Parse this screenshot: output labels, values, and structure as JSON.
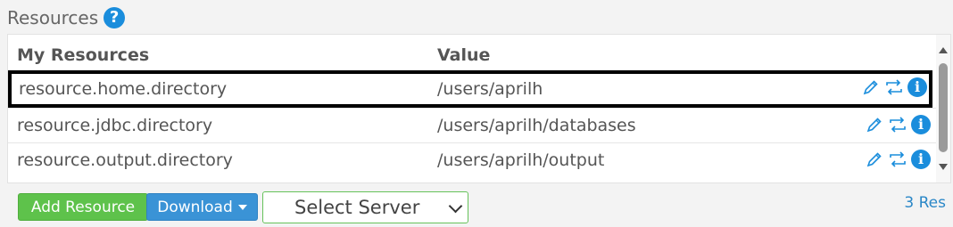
{
  "panel": {
    "title": "Resources",
    "help_icon": "question-circle-icon"
  },
  "table": {
    "headers": [
      "My Resources",
      "Value"
    ],
    "rows": [
      {
        "key": "resource.home.directory",
        "value": "/users/aprilh",
        "selected": true
      },
      {
        "key": "resource.jdbc.directory",
        "value": "/users/aprilh/databases",
        "selected": false
      },
      {
        "key": "resource.output.directory",
        "value": "/users/aprilh/output",
        "selected": false
      }
    ],
    "row_actions": [
      "pencil-edit-icon",
      "swap-arrows-icon",
      "info-circle-icon"
    ]
  },
  "footer": {
    "add_label": "Add Resource",
    "download_label": "Download",
    "select_server_label": "Select Server",
    "count_text": "3 Res"
  },
  "colors": {
    "accent_blue": "#1a8ddc",
    "add_green": "#5ec24b",
    "download_blue": "#3a93d6",
    "selected_border": "#000000"
  }
}
